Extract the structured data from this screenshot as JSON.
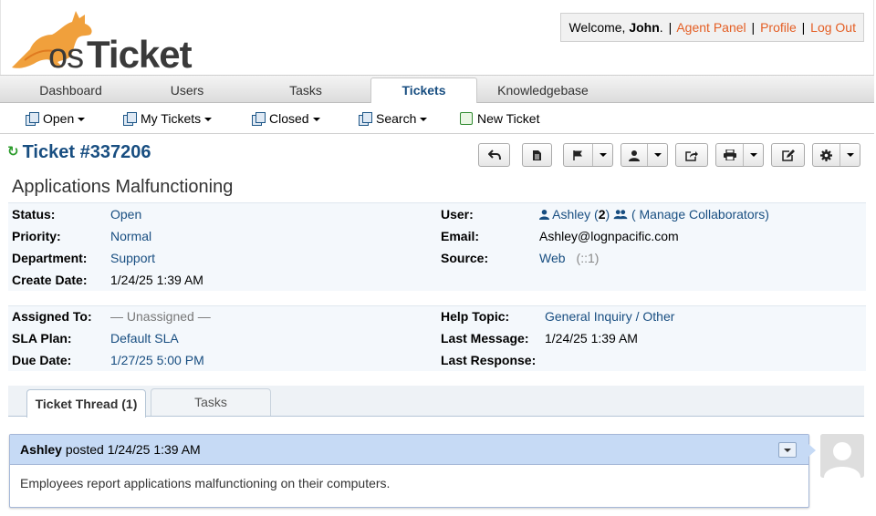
{
  "header": {
    "logo_text": "osTicket",
    "welcome_prefix": "Welcome, ",
    "user_name": "John",
    "welcome_suffix": ".",
    "agent_panel": "Agent Panel",
    "profile": "Profile",
    "logout": "Log Out",
    "separator": "|"
  },
  "nav": {
    "tabs": [
      {
        "label": "Dashboard"
      },
      {
        "label": "Users"
      },
      {
        "label": "Tasks"
      },
      {
        "label": "Tickets",
        "active": true
      },
      {
        "label": "Knowledgebase"
      }
    ]
  },
  "subnav": {
    "items": [
      {
        "label": "Open",
        "icon": "copy-icon",
        "dropdown": true
      },
      {
        "label": "My Tickets",
        "icon": "copy-icon",
        "dropdown": true
      },
      {
        "label": "Closed",
        "icon": "copy-icon",
        "dropdown": true
      },
      {
        "label": "Search",
        "icon": "copy-icon",
        "dropdown": true
      },
      {
        "label": "New Ticket",
        "icon": "new-ticket-icon",
        "dropdown": false
      }
    ]
  },
  "ticket": {
    "title": "Ticket #337206",
    "subject": "Applications Malfunctioning"
  },
  "toolbar": {
    "buttons": [
      "reply-icon",
      "note-icon",
      "flag-icon",
      "user-icon",
      "transfer-icon",
      "print-icon",
      "edit-icon",
      "gear-icon"
    ]
  },
  "info1": {
    "status_label": "Status:",
    "status": "Open",
    "priority_label": "Priority:",
    "priority": "Normal",
    "department_label": "Department:",
    "department": "Support",
    "create_date_label": "Create Date:",
    "create_date": "1/24/25 1:39 AM",
    "user_label": "User:",
    "user": "Ashley",
    "user_count_open": "(",
    "user_count": "2",
    "user_count_close": ")",
    "manage_collab": "( Manage Collaborators)",
    "email_label": "Email:",
    "email": "Ashley@lognpacific.com",
    "source_label": "Source:",
    "source": "Web",
    "source_ip": "(::1)"
  },
  "info2": {
    "assigned_label": "Assigned To:",
    "assigned": "— Unassigned —",
    "sla_label": "SLA Plan:",
    "sla": "Default SLA",
    "due_label": "Due Date:",
    "due": "1/27/25 5:00 PM",
    "help_topic_label": "Help Topic:",
    "help_topic": "General Inquiry / Other",
    "last_message_label": "Last Message:",
    "last_message": "1/24/25 1:39 AM",
    "last_response_label": "Last Response:",
    "last_response": ""
  },
  "thread_tabs": [
    {
      "label": "Ticket Thread (1)",
      "active": true
    },
    {
      "label": "Tasks",
      "active": false
    }
  ],
  "entry": {
    "author": "Ashley",
    "posted": "posted 1/24/25 1:39 AM",
    "body": "Employees report applications malfunctioning on their computers."
  },
  "colors": {
    "brand_orange": "#e45e24",
    "link_blue": "#184e81",
    "entry_header": "#c6daf5"
  }
}
